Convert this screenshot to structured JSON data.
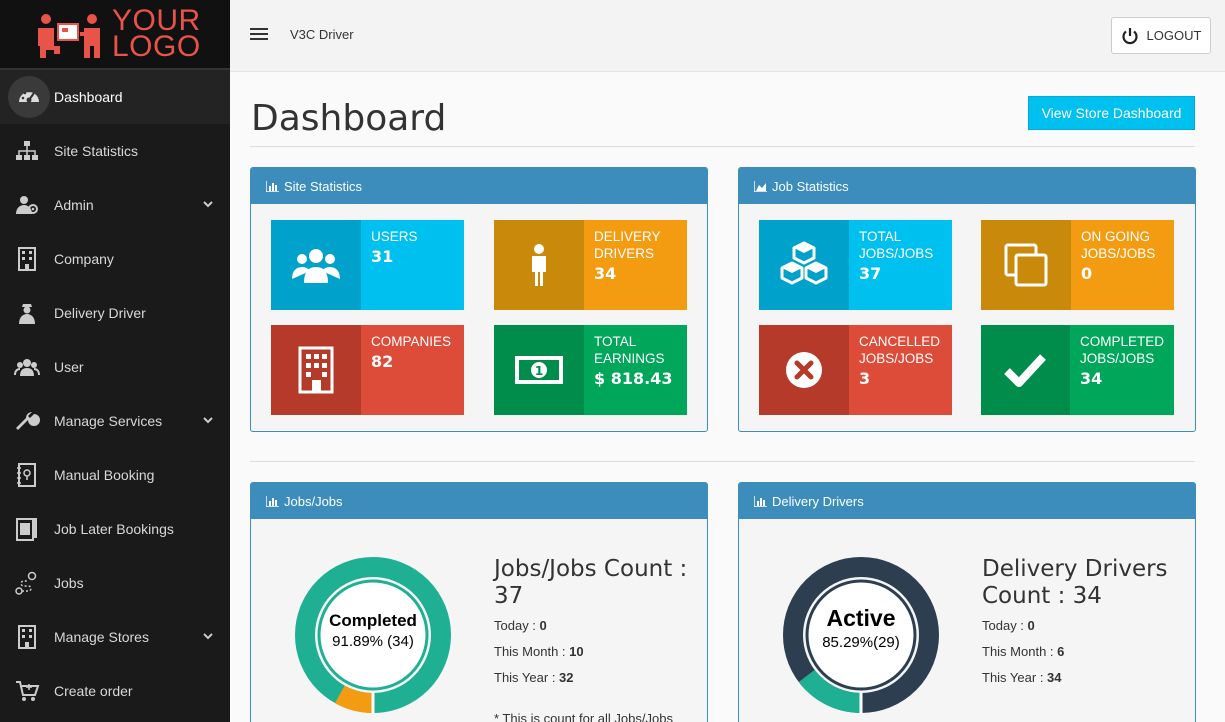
{
  "brand": {
    "logo_line1": "YOUR",
    "logo_line2": "LOGO",
    "app_name": "V3C Driver"
  },
  "topbar": {
    "logout_label": "LOGOUT"
  },
  "sidebar": {
    "items": [
      {
        "label": "Dashboard",
        "icon": "dashboard-icon",
        "active": true,
        "has_chevron": false
      },
      {
        "label": "Site Statistics",
        "icon": "sitemap-icon",
        "active": false,
        "has_chevron": false
      },
      {
        "label": "Admin",
        "icon": "admin-icon",
        "active": false,
        "has_chevron": true
      },
      {
        "label": "Company",
        "icon": "building-icon",
        "active": false,
        "has_chevron": false
      },
      {
        "label": "Delivery Driver",
        "icon": "driver-icon",
        "active": false,
        "has_chevron": false
      },
      {
        "label": "User",
        "icon": "users-icon",
        "active": false,
        "has_chevron": false
      },
      {
        "label": "Manage Services",
        "icon": "wrench-icon",
        "active": false,
        "has_chevron": true
      },
      {
        "label": "Manual Booking",
        "icon": "booking-icon",
        "active": false,
        "has_chevron": false
      },
      {
        "label": "Job Later Bookings",
        "icon": "later-booking-icon",
        "active": false,
        "has_chevron": false
      },
      {
        "label": "Jobs",
        "icon": "route-icon",
        "active": false,
        "has_chevron": false
      },
      {
        "label": "Manage Stores",
        "icon": "store-icon",
        "active": false,
        "has_chevron": true
      },
      {
        "label": "Create order",
        "icon": "cart-icon",
        "active": false,
        "has_chevron": false
      }
    ]
  },
  "main": {
    "title": "Dashboard",
    "store_button": "View Store Dashboard",
    "site_stats": {
      "title": "Site Statistics",
      "tiles": [
        {
          "label": "USERS",
          "value": "31"
        },
        {
          "label": "DELIVERY DRIVERS",
          "value": "34"
        },
        {
          "label": "COMPANIES",
          "value": "82"
        },
        {
          "label": "TOTAL EARNINGS",
          "value": "$ 818.43"
        }
      ]
    },
    "job_stats": {
      "title": "Job Statistics",
      "tiles": [
        {
          "label": "TOTAL JOBS/JOBS",
          "value": "37"
        },
        {
          "label": "ON GOING JOBS/JOBS",
          "value": "0"
        },
        {
          "label": "CANCELLED JOBS/JOBS",
          "value": "3"
        },
        {
          "label": "COMPLETED JOBS/JOBS",
          "value": "34"
        }
      ]
    },
    "jobs_panel": {
      "title": "Jobs/Jobs",
      "count_title": "Jobs/Jobs Count : 37",
      "today_label": "Today : ",
      "today": "0",
      "month_label": "This Month : ",
      "month": "10",
      "year_label": "This Year : ",
      "year": "32",
      "note": "* This is count for all Jobs/Jobs",
      "donut": {
        "label": "Completed",
        "value_text": "91.89% (34)",
        "fraction": 0.9189,
        "color": "#1fb094",
        "rest_color": "#f39c12"
      }
    },
    "drivers_panel": {
      "title": "Delivery Drivers",
      "count_title": "Delivery Drivers Count : 34",
      "today_label": "Today : ",
      "today": "0",
      "month_label": "This Month : ",
      "month": "6",
      "year_label": "This Year : ",
      "year": "34",
      "donut": {
        "label": "Active",
        "value_text": "85.29%(29)",
        "fraction": 0.8529,
        "color": "#2c3e50",
        "rest_color": "#1fb094"
      }
    }
  },
  "colors": {
    "sidebar_bg": "#1a1a1a",
    "panel_header": "#3c8dbc",
    "accent_button": "#00c0ef",
    "logo": "#e8534a"
  }
}
